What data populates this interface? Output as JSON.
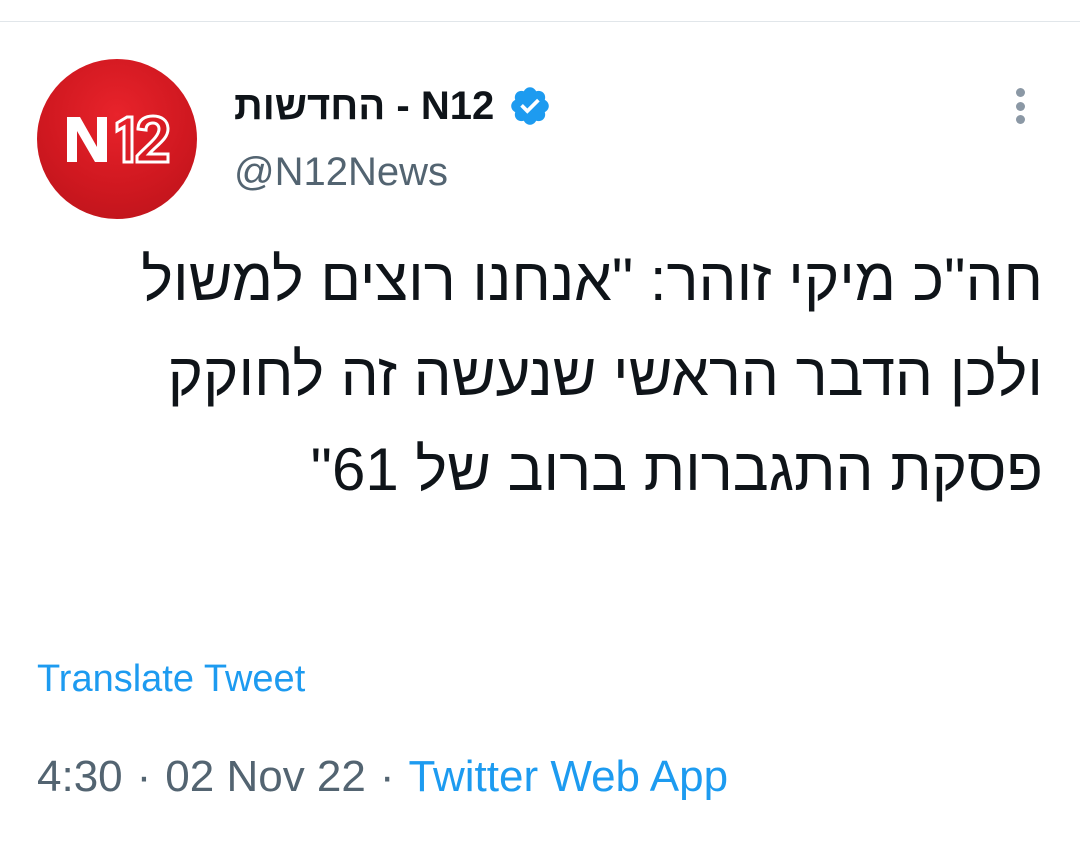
{
  "tweet": {
    "author": {
      "display_name": "החדשות - N12",
      "handle": "@N12News",
      "verified": true,
      "avatar_text": "N12",
      "avatar_color": "#d71920"
    },
    "text": "חה\"כ מיקי זוהר: \"אנחנו רוצים למשול ולכן הדבר הראשי שנעשה זה לחוקק פסקת התגברות ברוב של 61\"",
    "translate_label": "Translate Tweet",
    "time": "4:30",
    "date": "02 Nov 22",
    "separator": "·",
    "source": "Twitter Web App"
  },
  "colors": {
    "accent": "#1d9bf0",
    "secondary_text": "#536471",
    "primary_text": "#0f1419"
  },
  "icons": {
    "verified": "verified-badge-icon",
    "more": "more-options-icon"
  }
}
